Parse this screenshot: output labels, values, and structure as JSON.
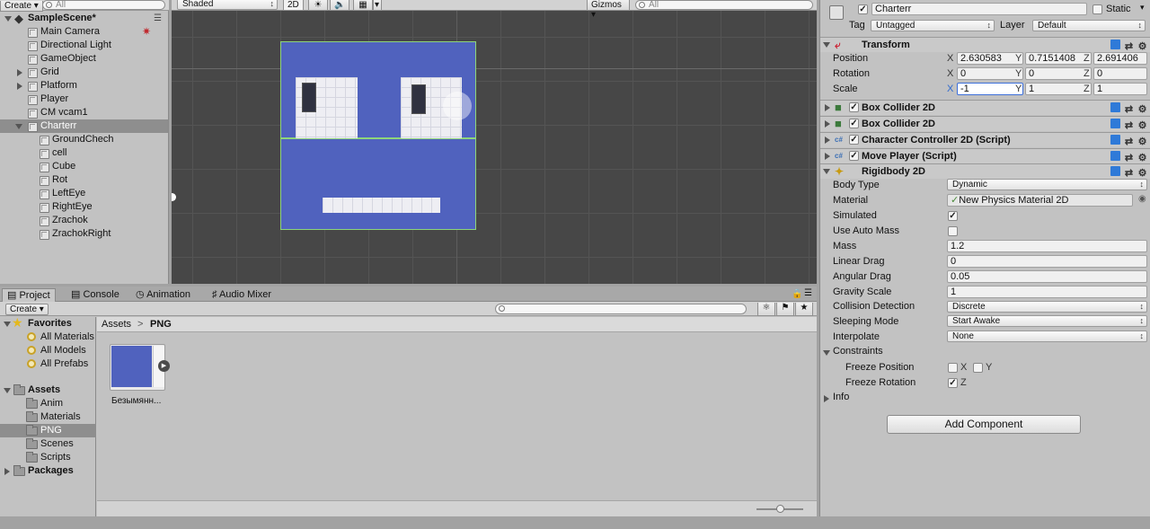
{
  "hierarchy": {
    "create_label": "Create",
    "search_placeholder": "All",
    "scene_name": "SampleScene*",
    "items": [
      {
        "label": "Main Camera",
        "indent": 1
      },
      {
        "label": "Directional Light",
        "indent": 1
      },
      {
        "label": "GameObject",
        "indent": 1
      },
      {
        "label": "Grid",
        "indent": 1,
        "expandable": true
      },
      {
        "label": "Platform",
        "indent": 1,
        "expandable": true
      },
      {
        "label": "Player",
        "indent": 1
      },
      {
        "label": "CM vcam1",
        "indent": 1
      },
      {
        "label": "Charterr",
        "indent": 1,
        "expanded": true,
        "selected": true
      },
      {
        "label": "GroundChech",
        "indent": 2
      },
      {
        "label": "cell",
        "indent": 2
      },
      {
        "label": "Cube",
        "indent": 2
      },
      {
        "label": "Rot",
        "indent": 2
      },
      {
        "label": "LeftEye",
        "indent": 2
      },
      {
        "label": "RightEye",
        "indent": 2
      },
      {
        "label": "Zrachok",
        "indent": 2
      },
      {
        "label": "ZrachokRight",
        "indent": 2
      }
    ]
  },
  "scene": {
    "shading_mode": "Shaded",
    "mode_2d": "2D",
    "gizmos_label": "Gizmos",
    "search_placeholder": "All",
    "character_color": "#5062be"
  },
  "project": {
    "tabs": [
      {
        "label": "Project",
        "active": true
      },
      {
        "label": "Console"
      },
      {
        "label": "Animation"
      },
      {
        "label": "Audio Mixer"
      }
    ],
    "create_label": "Create",
    "favorites_label": "Favorites",
    "favorites": [
      "All Materials",
      "All Models",
      "All Prefabs"
    ],
    "assets_label": "Assets",
    "folders": [
      "Anim",
      "Materials",
      "PNG",
      "Scenes",
      "Scripts"
    ],
    "selected_folder": "PNG",
    "packages_label": "Packages",
    "breadcrumb": [
      "Assets",
      "PNG"
    ],
    "breadcrumb_sep": ">",
    "asset_name": "Безымянн...",
    "zoom_level": 0.5
  },
  "inspector": {
    "object_name": "Charterr",
    "static_label": "Static",
    "tag_label": "Tag",
    "tag_value": "Untagged",
    "layer_label": "Layer",
    "layer_value": "Default",
    "transform": {
      "title": "Transform",
      "position_label": "Position",
      "rotation_label": "Rotation",
      "scale_label": "Scale",
      "x_label": "X",
      "y_label": "Y",
      "z_label": "Z",
      "position": {
        "x": "2.630583",
        "y": "0.7151408",
        "z": "2.691406"
      },
      "rotation": {
        "x": "0",
        "y": "0",
        "z": "0"
      },
      "scale": {
        "x": "-1",
        "y": "1",
        "z": "1"
      }
    },
    "components": [
      {
        "title": "Box Collider 2D"
      },
      {
        "title": "Box Collider 2D"
      },
      {
        "title": "Character Controller 2D (Script)"
      },
      {
        "title": "Move Player (Script)"
      }
    ],
    "rigidbody": {
      "title": "Rigidbody 2D",
      "body_type_label": "Body Type",
      "body_type": "Dynamic",
      "material_label": "Material",
      "material": "New Physics Material 2D",
      "simulated_label": "Simulated",
      "auto_mass_label": "Use Auto Mass",
      "mass_label": "Mass",
      "mass": "1.2",
      "linear_drag_label": "Linear Drag",
      "linear_drag": "0",
      "angular_drag_label": "Angular Drag",
      "angular_drag": "0.05",
      "gravity_label": "Gravity Scale",
      "gravity": "1",
      "collision_label": "Collision Detection",
      "collision": "Discrete",
      "sleeping_label": "Sleeping Mode",
      "sleeping": "Start Awake",
      "interpolate_label": "Interpolate",
      "interpolate": "None",
      "constraints_label": "Constraints",
      "freeze_position_label": "Freeze Position",
      "freeze_rotation_label": "Freeze Rotation",
      "x_label": "X",
      "y_label": "Y",
      "z_label": "Z",
      "info_label": "Info"
    },
    "add_component_label": "Add Component"
  }
}
